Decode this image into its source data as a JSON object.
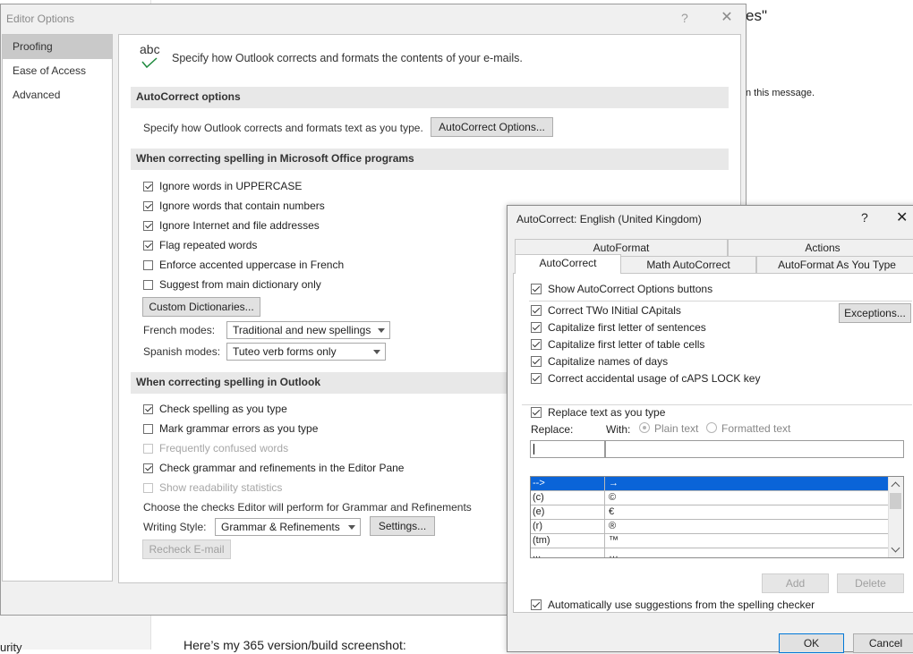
{
  "background": {
    "title_fragment": "es\"",
    "message_fragment": "n this message.",
    "bottom_left_fragment": "urity",
    "bottom_text": "Here’s my 365 version/build screenshot:"
  },
  "editor_options": {
    "title": "Editor Options",
    "help": "?",
    "close": "✕",
    "nav": [
      {
        "label": "Proofing",
        "selected": true
      },
      {
        "label": "Ease of Access",
        "selected": false
      },
      {
        "label": "Advanced",
        "selected": false
      }
    ],
    "header_icon_text": "abc",
    "header_text": "Specify how Outlook corrects and formats the contents of your e-mails.",
    "autocorrect_section": {
      "title": "AutoCorrect options",
      "description": "Specify how Outlook corrects and formats text as you type.",
      "button": "AutoCorrect Options..."
    },
    "office_section": {
      "title": "When correcting spelling in Microsoft Office programs",
      "options": [
        {
          "label": "Ignore words in UPPERCASE",
          "checked": true
        },
        {
          "label": "Ignore words that contain numbers",
          "checked": true
        },
        {
          "label": "Ignore Internet and file addresses",
          "checked": true
        },
        {
          "label": "Flag repeated words",
          "checked": true
        },
        {
          "label": "Enforce accented uppercase in French",
          "checked": false
        },
        {
          "label": "Suggest from main dictionary only",
          "checked": false
        }
      ],
      "custom_dictionaries_button": "Custom Dictionaries...",
      "french_modes_label": "French modes:",
      "french_modes_value": "Traditional and new spellings",
      "spanish_modes_label": "Spanish modes:",
      "spanish_modes_value": "Tuteo verb forms only"
    },
    "outlook_section": {
      "title": "When correcting spelling in Outlook",
      "options": [
        {
          "label": "Check spelling as you type",
          "checked": true,
          "disabled": false
        },
        {
          "label": "Mark grammar errors as you type",
          "checked": false,
          "disabled": false
        },
        {
          "label": "Frequently confused words",
          "checked": false,
          "disabled": true
        },
        {
          "label": "Check grammar and refinements in the Editor Pane",
          "checked": true,
          "disabled": false
        },
        {
          "label": "Show readability statistics",
          "checked": false,
          "disabled": true
        }
      ],
      "checks_text": "Choose the checks Editor will perform for Grammar and Refinements",
      "writing_style_label": "Writing Style:",
      "writing_style_value": "Grammar & Refinements",
      "settings_button": "Settings...",
      "recheck_button": "Recheck E-mail"
    }
  },
  "autocorrect_dialog": {
    "title": "AutoCorrect: English (United Kingdom)",
    "help": "?",
    "close": "✕",
    "tabs_back": [
      "AutoFormat",
      "Actions"
    ],
    "tabs_front": [
      "AutoCorrect",
      "Math AutoCorrect",
      "AutoFormat As You Type"
    ],
    "show_buttons_option": {
      "label": "Show AutoCorrect Options buttons",
      "checked": true
    },
    "options": [
      {
        "label": "Correct TWo INitial CApitals",
        "checked": true
      },
      {
        "label": "Capitalize first letter of sentences",
        "checked": true
      },
      {
        "label": "Capitalize first letter of table cells",
        "checked": true
      },
      {
        "label": "Capitalize names of days",
        "checked": true
      },
      {
        "label": "Correct accidental usage of cAPS LOCK key",
        "checked": true
      }
    ],
    "exceptions_button": "Exceptions...",
    "replace_option": {
      "label": "Replace text as you type",
      "checked": true
    },
    "replace_label": "Replace:",
    "with_label": "With:",
    "plain_text_label": "Plain text",
    "formatted_text_label": "Formatted text",
    "replace_value": "",
    "with_value": "",
    "entries": [
      {
        "from": "-->",
        "to": "→",
        "selected": true
      },
      {
        "from": "(c)",
        "to": "©",
        "selected": false
      },
      {
        "from": "(e)",
        "to": "€",
        "selected": false
      },
      {
        "from": "(r)",
        "to": "®",
        "selected": false
      },
      {
        "from": "(tm)",
        "to": "™",
        "selected": false
      },
      {
        "from": "...",
        "to": "…",
        "selected": false
      }
    ],
    "add_button": "Add",
    "delete_button": "Delete",
    "suggestions_option": {
      "label": "Automatically use suggestions from the spelling checker",
      "checked": true
    },
    "ok_button": "OK",
    "cancel_button": "Cancel"
  }
}
